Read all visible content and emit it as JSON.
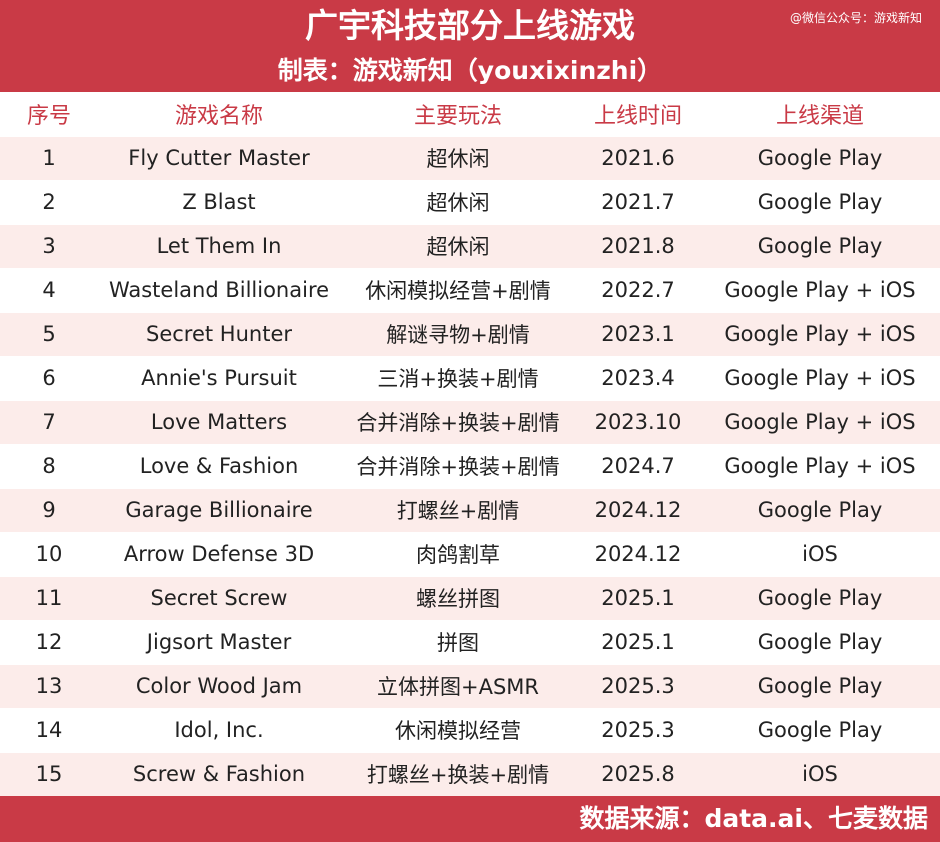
{
  "header": {
    "title": "广宇科技部分上线游戏",
    "subtitle": "制表：游戏新知（youxixinzhi）",
    "watermark": "@微信公众号：游戏新知"
  },
  "colors": {
    "accent": "#c93a46",
    "row_alt": "#fcecea"
  },
  "table": {
    "columns": [
      "序号",
      "游戏名称",
      "主要玩法",
      "上线时间",
      "上线渠道"
    ],
    "rows": [
      [
        "1",
        "Fly Cutter Master",
        "超休闲",
        "2021.6",
        "Google Play"
      ],
      [
        "2",
        "Z Blast",
        "超休闲",
        "2021.7",
        "Google Play"
      ],
      [
        "3",
        "Let Them In",
        "超休闲",
        "2021.8",
        "Google Play"
      ],
      [
        "4",
        "Wasteland Billionaire",
        "休闲模拟经营+剧情",
        "2022.7",
        "Google Play + iOS"
      ],
      [
        "5",
        "Secret Hunter",
        "解谜寻物+剧情",
        "2023.1",
        "Google Play + iOS"
      ],
      [
        "6",
        "Annie's Pursuit",
        "三消+换装+剧情",
        "2023.4",
        "Google Play + iOS"
      ],
      [
        "7",
        "Love Matters",
        "合并消除+换装+剧情",
        "2023.10",
        "Google Play + iOS"
      ],
      [
        "8",
        "Love & Fashion",
        "合并消除+换装+剧情",
        "2024.7",
        "Google Play + iOS"
      ],
      [
        "9",
        "Garage Billionaire",
        "打螺丝+剧情",
        "2024.12",
        "Google Play"
      ],
      [
        "10",
        "Arrow Defense 3D",
        "肉鸽割草",
        "2024.12",
        "iOS"
      ],
      [
        "11",
        "Secret Screw",
        "螺丝拼图",
        "2025.1",
        "Google Play"
      ],
      [
        "12",
        "Jigsort Master",
        "拼图",
        "2025.1",
        "Google Play"
      ],
      [
        "13",
        "Color Wood Jam",
        "立体拼图+ASMR",
        "2025.3",
        "Google Play"
      ],
      [
        "14",
        "Idol, Inc.",
        "休闲模拟经营",
        "2025.3",
        "Google Play"
      ],
      [
        "15",
        "Screw & Fashion",
        "打螺丝+换装+剧情",
        "2025.8",
        "iOS"
      ]
    ]
  },
  "footer": {
    "source": "数据来源：data.ai、七麦数据"
  }
}
